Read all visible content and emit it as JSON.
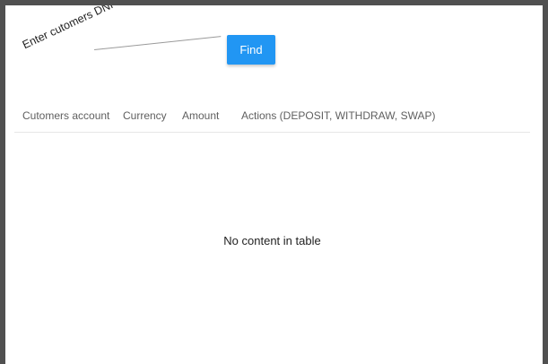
{
  "search": {
    "placeholder": "Enter cutomers DNI",
    "value": "",
    "button_label": "Find"
  },
  "table": {
    "columns": [
      "Cutomers account",
      "Currency",
      "Amount",
      "Actions (DEPOSIT, WITHDRAW, SWAP)"
    ],
    "empty_message": "No content in table"
  },
  "colors": {
    "accent": "#2196f3",
    "frame": "#505050",
    "background": "#ffffff"
  }
}
